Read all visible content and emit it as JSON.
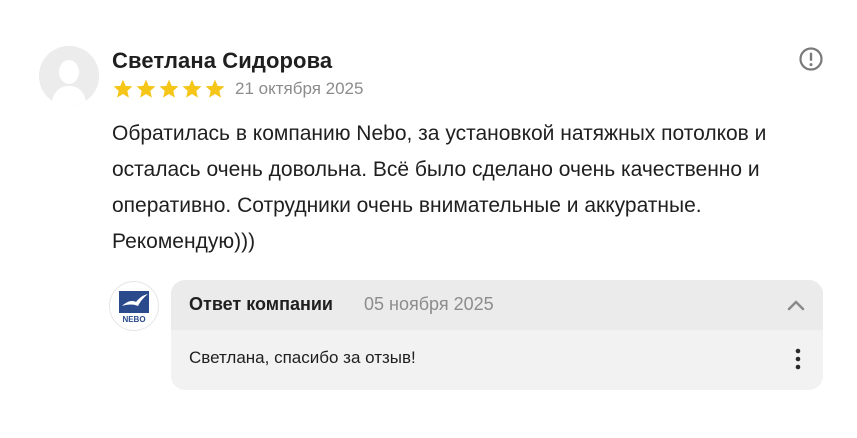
{
  "review": {
    "author": "Светлана Сидорова",
    "rating": 5,
    "rating_max": 5,
    "star_color": "#f5c518",
    "date": "21 октября 2025",
    "text": "Обратилась в компанию Nebo, за установкой натяжных потолков и осталась очень довольна. Всё было сделано очень качественно и оперативно. Сотрудники очень внимательные и аккуратные. Рекомендую)))",
    "complain_icon": "exclamation-circle-icon"
  },
  "reply": {
    "title": "Ответ компании",
    "date": "05 ноября 2025",
    "text": "Светлана, спасибо за отзыв!",
    "logo_text": "NEBO",
    "logo_color": "#2b4a8c",
    "collapse_icon": "chevron-up-icon",
    "more_icon": "more-vertical-icon"
  }
}
